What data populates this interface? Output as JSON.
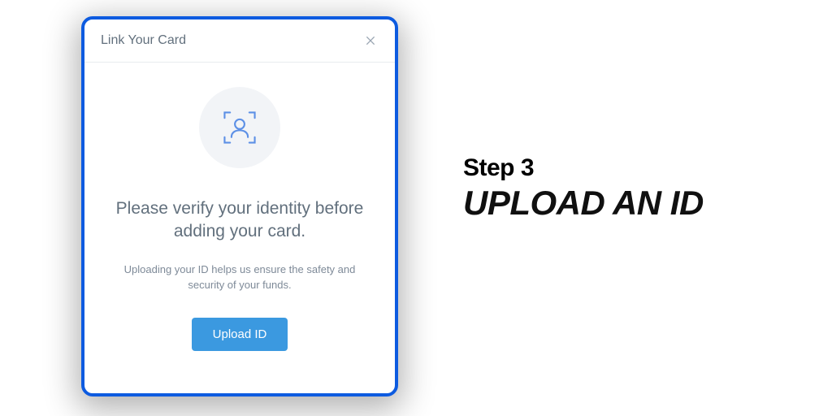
{
  "dialog": {
    "title": "Link Your Card",
    "headline": "Please verify your identity before adding your card.",
    "subtext": "Uploading your ID helps us ensure the safety and security of your funds.",
    "primary_button": "Upload ID"
  },
  "step": {
    "label": "Step 3",
    "title": "UPLOAD AN ID"
  },
  "colors": {
    "accent_border": "#0d5be0",
    "primary_button": "#3b99e0",
    "icon_stroke": "#5d90e6"
  }
}
